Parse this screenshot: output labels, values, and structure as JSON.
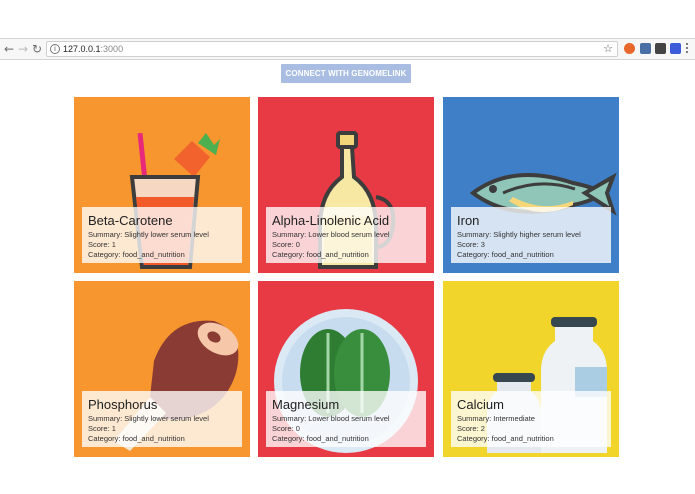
{
  "browser": {
    "url_host": "127.0.0.1",
    "url_port": ":3000"
  },
  "page": {
    "connect_button": "CONNECT WITH GENOMELINK"
  },
  "labels": {
    "summary": "Summary: ",
    "score": "Score: ",
    "category": "Category: "
  },
  "cards": [
    {
      "name": "Beta-Carotene",
      "summary": "Slightly lower serum level",
      "score": "1",
      "category": "food_and_nutrition",
      "color": "#f7962f"
    },
    {
      "name": "Alpha-Linolenic Acid",
      "summary": "Lower blood serum level",
      "score": "0",
      "category": "food_and_nutrition",
      "color": "#e73a44"
    },
    {
      "name": "Iron",
      "summary": "Slightly higher serum level",
      "score": "3",
      "category": "food_and_nutrition",
      "color": "#3f7fc7"
    },
    {
      "name": "Phosphorus",
      "summary": "Slightly lower serum level",
      "score": "1",
      "category": "food_and_nutrition",
      "color": "#f7962f"
    },
    {
      "name": "Magnesium",
      "summary": "Lower blood serum level",
      "score": "0",
      "category": "food_and_nutrition",
      "color": "#e73a44"
    },
    {
      "name": "Calcium",
      "summary": "Intermediate",
      "score": "2",
      "category": "food_and_nutrition",
      "color": "#f1d52b"
    }
  ]
}
